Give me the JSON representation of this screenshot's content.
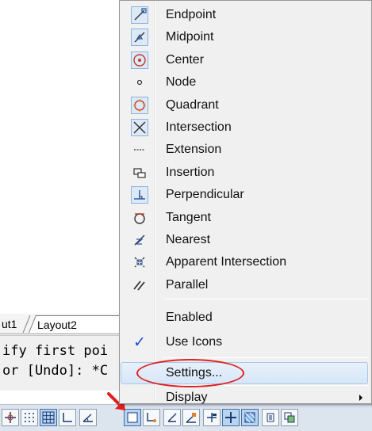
{
  "tabs": {
    "layout1": "ut1",
    "layout2": "Layout2"
  },
  "command_line": {
    "line1": "ify first poi",
    "line2": "or [Undo]: *C"
  },
  "menu": {
    "items": [
      {
        "label": "Endpoint",
        "icon": "endpoint-icon"
      },
      {
        "label": "Midpoint",
        "icon": "midpoint-icon"
      },
      {
        "label": "Center",
        "icon": "center-icon"
      },
      {
        "label": "Node",
        "icon": "node-icon"
      },
      {
        "label": "Quadrant",
        "icon": "quadrant-icon"
      },
      {
        "label": "Intersection",
        "icon": "intersection-icon"
      },
      {
        "label": "Extension",
        "icon": "extension-icon"
      },
      {
        "label": "Insertion",
        "icon": "insertion-icon"
      },
      {
        "label": "Perpendicular",
        "icon": "perpendicular-icon"
      },
      {
        "label": "Tangent",
        "icon": "tangent-icon"
      },
      {
        "label": "Nearest",
        "icon": "nearest-icon"
      },
      {
        "label": "Apparent Intersection",
        "icon": "apparent-intersection-icon"
      },
      {
        "label": "Parallel",
        "icon": "parallel-icon"
      }
    ],
    "enabled_label": "Enabled",
    "use_icons_label": "Use Icons",
    "use_icons_check": "✓",
    "settings_label": "Settings...",
    "display_label": "Display"
  },
  "colors": {
    "accent": "#1a4ed1",
    "annotation_red": "#e02020"
  }
}
